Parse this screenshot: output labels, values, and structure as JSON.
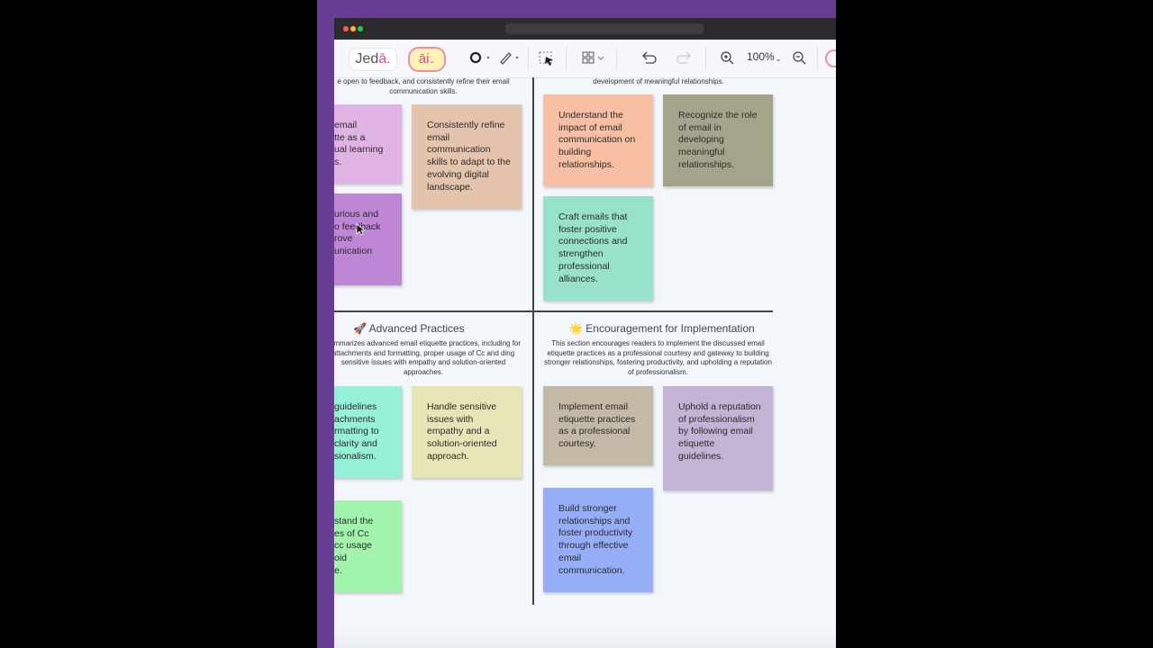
{
  "toolbar": {
    "logo_text": "Jed",
    "logo_dot": "ā.",
    "ai_label": "āi",
    "zoom": "100%"
  },
  "board": {
    "top_left_desc": "e open to feedback, and consistently refine their email communication skills.",
    "top_right_desc": "development of meaningful relationships.",
    "bottom_left": {
      "heading": "🚀 Advanced Practices",
      "desc": "summarizes advanced email etiquette practices, including for attachments and formatting, proper usage of Cc and ding sensitive issues with empathy and solution-oriented approaches."
    },
    "bottom_right": {
      "heading": "🌟 Encouragement for Implementation",
      "desc": "This section encourages readers to implement the discussed email etiquette practices as a professional courtesy and gateway to building stronger relationships, fostering productivity, and upholding a reputation of professionalism."
    },
    "notes": [
      {
        "text": "email\ntte as a\nual learning\ns.",
        "color": "#dfb3e3"
      },
      {
        "text": "Consistently refine email communication skills to adapt to the evolving digital landscape.",
        "color": "#e5c4ad"
      },
      {
        "text": "urious and\no feedback\nrove\nunication",
        "color": "#be86d4"
      },
      {
        "text": "Understand the impact of email communication on building relationships.",
        "color": "#f7bfa3"
      },
      {
        "text": "Recognize the role of email in developing meaningful relationships.",
        "color": "#a6a38c"
      },
      {
        "text": "Craft emails that foster positive connections and strengthen professional alliances.",
        "color": "#98e2cc"
      },
      {
        "text": "guidelines\nachments\nrmatting to\nclarity and\nsionalism.",
        "color": "#96f1d6"
      },
      {
        "text": "Handle sensitive issues with empathy and a solution-oriented approach.",
        "color": "#e7e5b5"
      },
      {
        "text": "stand the\nes of Cc\ncc usage\noid\ne.",
        "color": "#a2f4ad"
      },
      {
        "text": "Implement email etiquette practices as a professional courtesy.",
        "color": "#c4b8a7"
      },
      {
        "text": "Uphold a reputation of professionalism by following email etiquette guidelines.",
        "color": "#c3b3d4"
      },
      {
        "text": "Build stronger relationships and foster productivity through effective email communication.",
        "color": "#96aef8"
      }
    ]
  }
}
